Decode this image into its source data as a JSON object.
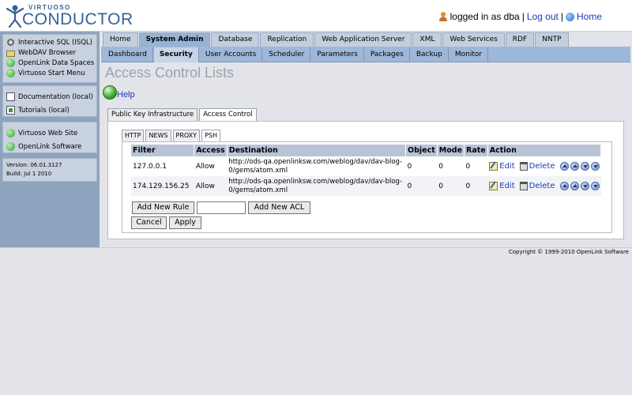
{
  "header": {
    "logo_small": "VIRTUOSO",
    "logo_big": "CONDUCTOR",
    "logged_in": "logged in as dba",
    "separator1": "|",
    "logout": "Log out",
    "separator2": "|",
    "home": "Home"
  },
  "sidebar": {
    "group1": [
      {
        "label": "Interactive SQL (ISQL)",
        "icon": "gear-icon"
      },
      {
        "label": "WebDAV Browser",
        "icon": "folder-icon"
      },
      {
        "label": "OpenLink Data Spaces",
        "icon": "globe-icon"
      },
      {
        "label": "Virtuoso Start Menu",
        "icon": "globe-icon"
      }
    ],
    "group2": [
      {
        "label": "Documentation (local)",
        "icon": "document-icon"
      },
      {
        "label": "Tutorials (local)",
        "icon": "tutorial-icon"
      }
    ],
    "group3": [
      {
        "label": "Virtuoso Web Site",
        "icon": "globe-icon"
      },
      {
        "label": "OpenLink Software",
        "icon": "globe-icon"
      }
    ],
    "version": "Version: 06.01.3127",
    "build": "Build: Jul 1 2010"
  },
  "nav_primary": [
    {
      "label": "Home",
      "active": false
    },
    {
      "label": "System Admin",
      "active": true
    },
    {
      "label": "Database",
      "active": false
    },
    {
      "label": "Replication",
      "active": false
    },
    {
      "label": "Web Application Server",
      "active": false
    },
    {
      "label": "XML",
      "active": false
    },
    {
      "label": "Web Services",
      "active": false
    },
    {
      "label": "RDF",
      "active": false
    },
    {
      "label": "NNTP",
      "active": false
    }
  ],
  "nav_secondary": [
    {
      "label": "Dashboard",
      "active": false
    },
    {
      "label": "Security",
      "active": true
    },
    {
      "label": "User Accounts",
      "active": false
    },
    {
      "label": "Scheduler",
      "active": false
    },
    {
      "label": "Parameters",
      "active": false
    },
    {
      "label": "Packages",
      "active": false
    },
    {
      "label": "Backup",
      "active": false
    },
    {
      "label": "Monitor",
      "active": false
    }
  ],
  "page": {
    "title": "Access Control Lists",
    "help": "Help"
  },
  "outer_tabs": [
    {
      "label": "Public Key Infrastructure",
      "active": false
    },
    {
      "label": "Access Control",
      "active": true
    }
  ],
  "inner_tabs": [
    {
      "label": "HTTP",
      "active": false
    },
    {
      "label": "NEWS",
      "active": false
    },
    {
      "label": "PROXY",
      "active": false
    },
    {
      "label": "PSH",
      "active": true
    }
  ],
  "table": {
    "columns": [
      "Filter",
      "Access",
      "Destination",
      "Object",
      "Mode",
      "Rate",
      "Action"
    ],
    "rows": [
      {
        "filter": "127.0.0.1",
        "access": "Allow",
        "destination": "http://ods-qa.openlinksw.com/weblog/dav/dav-blog-0/gems/atom.xml",
        "object": "0",
        "mode": "0",
        "rate": "0"
      },
      {
        "filter": "174.129.156.25",
        "access": "Allow",
        "destination": "http://ods-qa.openlinksw.com/weblog/dav/dav-blog-0/gems/atom.xml",
        "object": "0",
        "mode": "0",
        "rate": "0"
      }
    ],
    "edit_label": "Edit",
    "delete_label": "Delete"
  },
  "buttons": {
    "add_rule": "Add New Rule",
    "add_acl": "Add New ACL",
    "acl_input_value": "",
    "cancel": "Cancel",
    "apply": "Apply"
  },
  "footer": {
    "copyright": "Copyright © 1999-2010 OpenLink Software"
  }
}
